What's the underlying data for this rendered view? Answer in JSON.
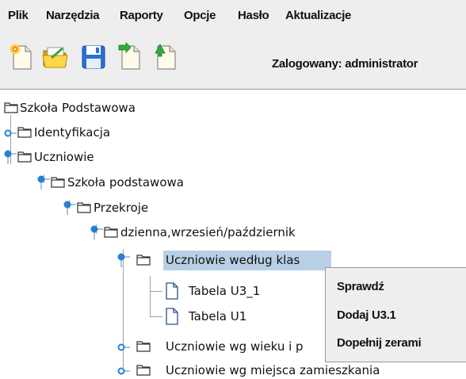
{
  "menu": {
    "items": [
      "Plik",
      "Narzędzia",
      "Raporty",
      "Opcje",
      "Hasło",
      "Aktualizacje"
    ]
  },
  "toolbar": {
    "buttons": [
      "new-document-icon",
      "open-folder-icon",
      "save-icon",
      "export-document-icon",
      "import-document-icon"
    ],
    "logged_in_text": "Zalogowany: administrator"
  },
  "tree": {
    "root": "Szkoła Podstawowa",
    "identyfikacja": "Identyfikacja",
    "uczniowie": "Uczniowie",
    "szkola_podstawowa": "Szkoła podstawowa",
    "przekroje": "Przekroje",
    "dzienna": "dzienna,wrzesień/październik",
    "wedlug_klas": "Uczniowie według klas",
    "tabela_u3_1": "Tabela U3_1",
    "tabela_u1": "Tabela U1",
    "wg_wieku": "Uczniowie wg wieku i p",
    "wg_miejsca": "Uczniowie wg miejsca zamieszkania"
  },
  "context_menu": {
    "items": [
      "Sprawdź",
      "Dodaj U3.1",
      "Dopełnij zerami"
    ]
  },
  "colors": {
    "selection": "#b8cfe5",
    "chrome": "#eeeeee",
    "handle": "#2a7fd4"
  }
}
